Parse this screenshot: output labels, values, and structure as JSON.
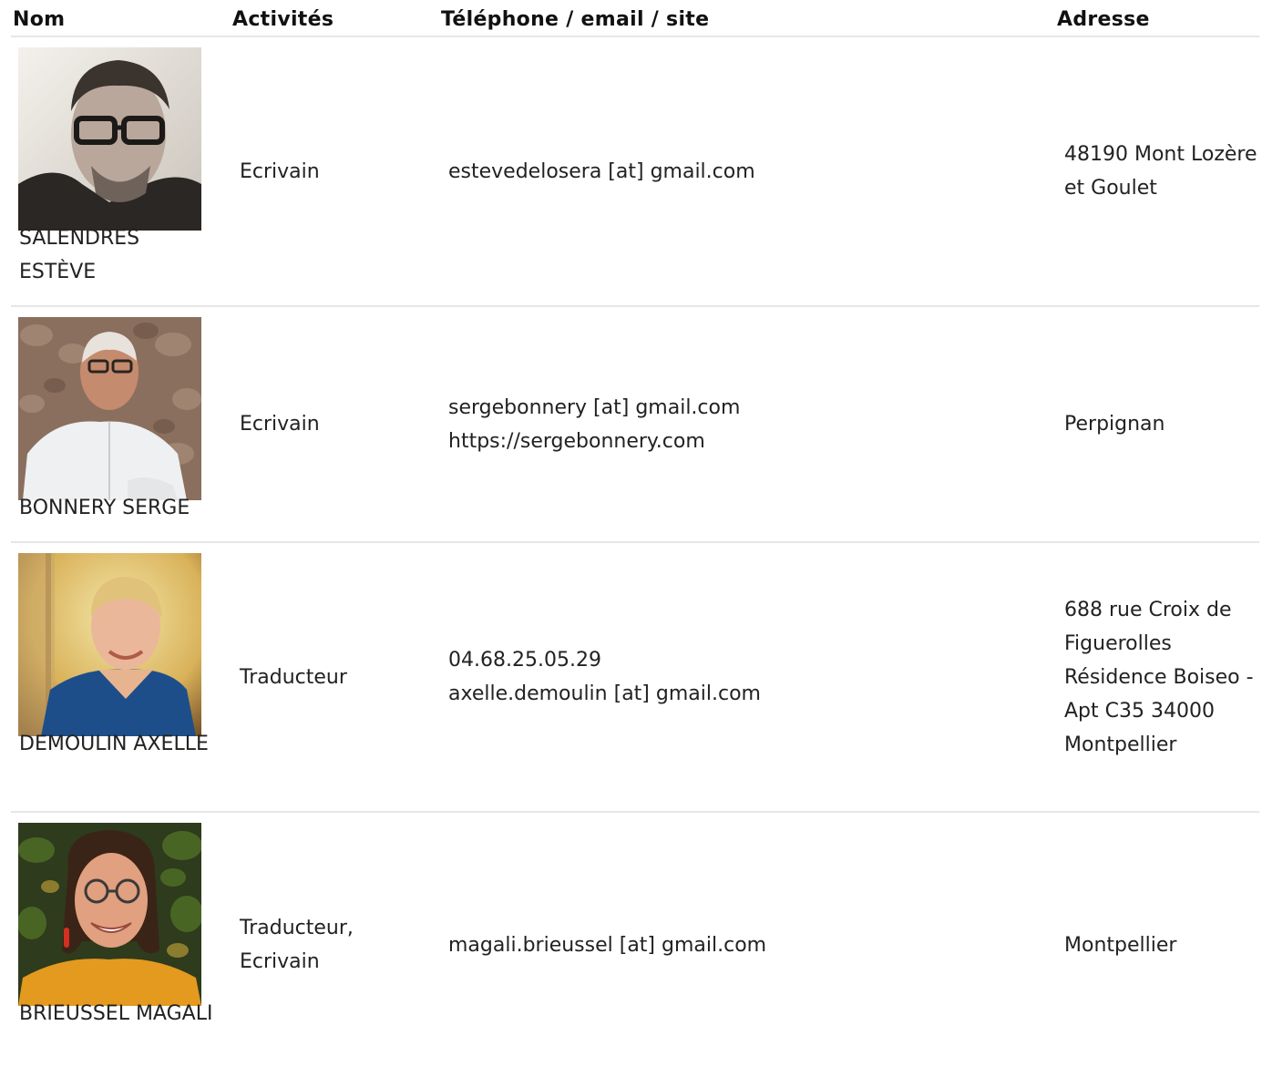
{
  "header": {
    "nom": "Nom",
    "activites": "Activités",
    "contact": "Téléphone / email / site",
    "adresse": "Adresse"
  },
  "rows": [
    {
      "name": "SALENDRES ESTÈVE",
      "activity": "Ecrivain",
      "contact": [
        "estevedelosera [at] gmail.com"
      ],
      "address": "48190 Mont Lozère et Goulet"
    },
    {
      "name": "BONNERY SERGE",
      "activity": "Ecrivain",
      "contact": [
        "sergebonnery [at] gmail.com",
        "https://sergebonnery.com"
      ],
      "address": "Perpignan"
    },
    {
      "name": "DEMOULIN AXELLE",
      "activity": "Traducteur",
      "contact": [
        "04.68.25.05.29",
        "axelle.demoulin [at] gmail.com"
      ],
      "address": "688 rue Croix de Figuerolles Résidence Boiseo - Apt C35 34000 Montpellier"
    },
    {
      "name": "BRIEUSSEL MAGALI",
      "activity": "Traducteur, Ecrivain",
      "contact": [
        "magali.brieussel [at] gmail.com"
      ],
      "address": "Montpellier"
    }
  ]
}
